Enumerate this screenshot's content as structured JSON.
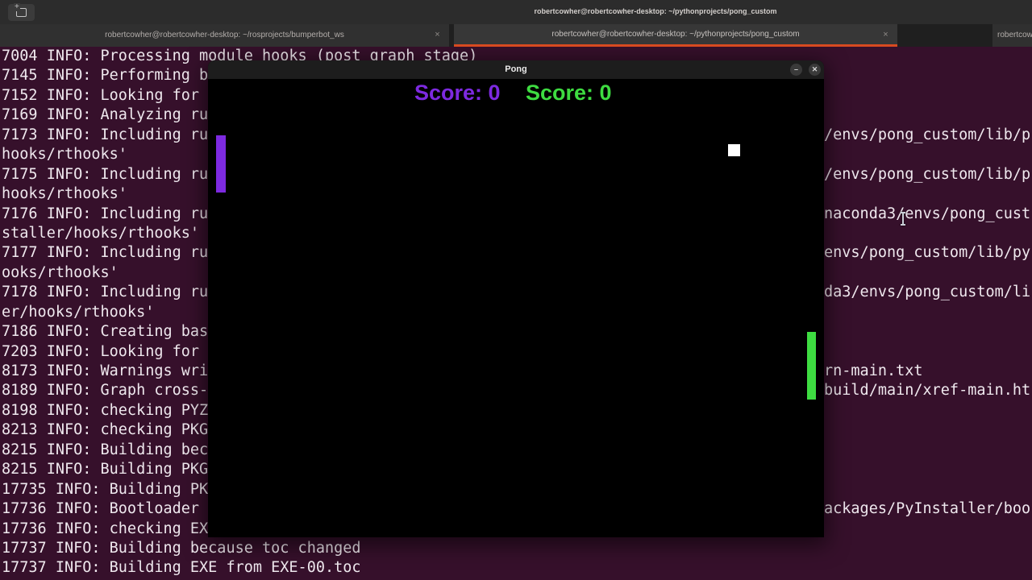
{
  "header": {
    "title": "robertcowher@robertcowher-desktop: ~/pythonprojects/pong_custom"
  },
  "tabs": [
    {
      "label": "robertcowher@robertcowher-desktop: ~/rosprojects/bumperbot_ws",
      "close_icon": "×",
      "active": false
    },
    {
      "label": "robertcowher@robertcowher-desktop: ~/pythonprojects/pong_custom",
      "close_icon": "×",
      "active": true
    },
    {
      "label": "robertcow",
      "active": false
    }
  ],
  "pong": {
    "window_title": "Pong",
    "minimize_icon": "–",
    "close_icon": "✕",
    "left_score_label": "Score: 0",
    "right_score_label": "Score: 0"
  },
  "colors": {
    "accent_tab_underline": "#D84A20",
    "terminal_background": "#36102B",
    "pong_left": "#7D2AE0",
    "pong_right": "#3EDC41",
    "ball": "#FFFFFF"
  },
  "terminal": {
    "lines": [
      {
        "left": "7004 INFO: Processing module hooks (post graph stage)",
        "right": ""
      },
      {
        "left": "7145 INFO: Performing b",
        "right": ""
      },
      {
        "left": "7152 INFO: Looking for ",
        "right": ""
      },
      {
        "left": "7169 INFO: Analyzing ru",
        "right": ""
      },
      {
        "left": "7173 INFO: Including ru",
        "right": "/envs/pong_custom/lib/p"
      },
      {
        "left": "hooks/rthooks'",
        "right": ""
      },
      {
        "left": "7175 INFO: Including ru",
        "right": "/envs/pong_custom/lib/p"
      },
      {
        "left": "hooks/rthooks'",
        "right": ""
      },
      {
        "left": "7176 INFO: Including ru",
        "right": "naconda3/envs/pong_cust"
      },
      {
        "left": "staller/hooks/rthooks'",
        "right": ""
      },
      {
        "left": "7177 INFO: Including ru",
        "right": "envs/pong_custom/lib/py"
      },
      {
        "left": "ooks/rthooks'",
        "right": ""
      },
      {
        "left": "7178 INFO: Including ru",
        "right": "da3/envs/pong_custom/li"
      },
      {
        "left": "er/hooks/rthooks'",
        "right": ""
      },
      {
        "left": "7186 INFO: Creating bas",
        "right": ""
      },
      {
        "left": "7203 INFO: Looking for ",
        "right": ""
      },
      {
        "left": "8173 INFO: Warnings wri",
        "right": "rn-main.txt"
      },
      {
        "left": "8189 INFO: Graph cross-",
        "right": "build/main/xref-main.ht"
      },
      {
        "left": "8198 INFO: checking PYZ",
        "right": ""
      },
      {
        "left": "8213 INFO: checking PKG",
        "right": ""
      },
      {
        "left": "8215 INFO: Building bec",
        "right": ""
      },
      {
        "left": "8215 INFO: Building PKG",
        "right": ""
      },
      {
        "left": "17735 INFO: Building PK",
        "right": ""
      },
      {
        "left": "17736 INFO: Bootloader ",
        "right": "ackages/PyInstaller/boo"
      },
      {
        "left": "17736 INFO: checking EX",
        "right": ""
      },
      {
        "left": "17737 INFO: Building because toc changed",
        "right": ""
      },
      {
        "left": "17737 INFO: Building EXE from EXE-00.toc",
        "right": ""
      }
    ]
  }
}
